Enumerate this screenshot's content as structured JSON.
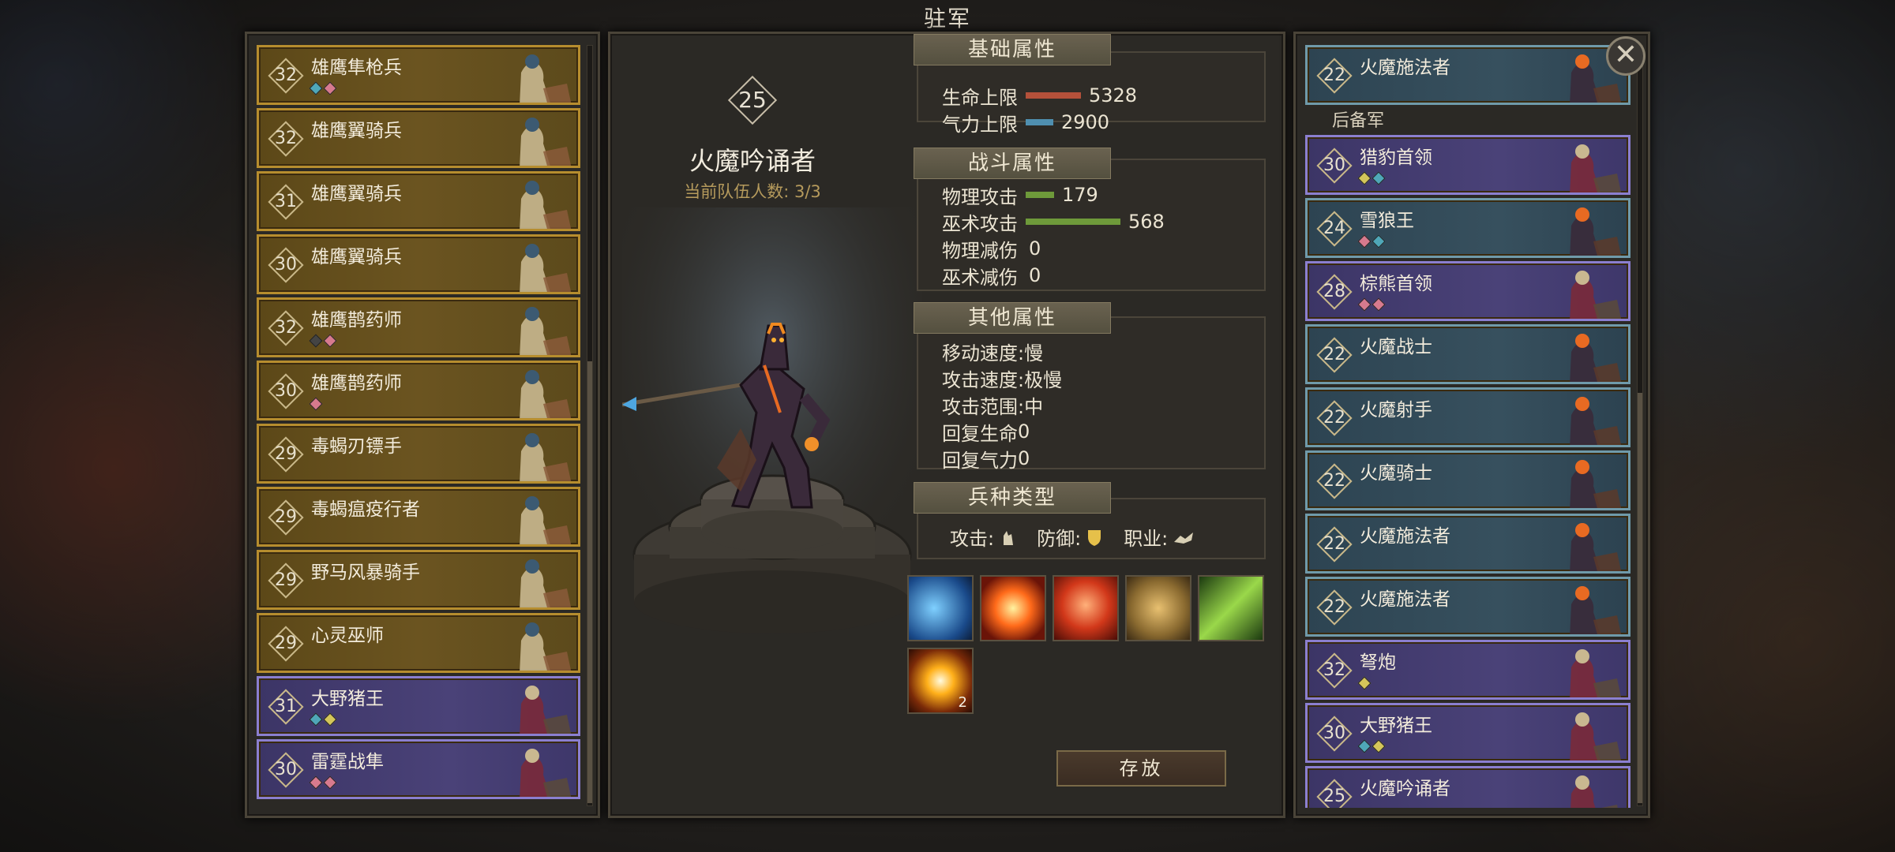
{
  "title": "驻军",
  "left_list": [
    {
      "level": "32",
      "name": "雄鹰隼枪兵",
      "style": "gold",
      "gems": [
        "#4fa7b8",
        "#d77a8e"
      ]
    },
    {
      "level": "32",
      "name": "雄鹰翼骑兵",
      "style": "gold",
      "gems": []
    },
    {
      "level": "31",
      "name": "雄鹰翼骑兵",
      "style": "gold",
      "gems": []
    },
    {
      "level": "30",
      "name": "雄鹰翼骑兵",
      "style": "gold",
      "gems": []
    },
    {
      "level": "32",
      "name": "雄鹰鹊药师",
      "style": "gold",
      "gems": [
        "#444444",
        "#d77a8e"
      ]
    },
    {
      "level": "30",
      "name": "雄鹰鹊药师",
      "style": "gold",
      "gems": [
        "#d77a8e"
      ]
    },
    {
      "level": "29",
      "name": "毒蝎刃镖手",
      "style": "gold",
      "gems": []
    },
    {
      "level": "29",
      "name": "毒蝎瘟疫行者",
      "style": "gold",
      "gems": []
    },
    {
      "level": "29",
      "name": "野马风暴骑手",
      "style": "gold",
      "gems": []
    },
    {
      "level": "29",
      "name": "心灵巫师",
      "style": "gold",
      "gems": []
    },
    {
      "level": "31",
      "name": "大野猪王",
      "style": "purple",
      "gems": [
        "#4fa7b8",
        "#d4c65a"
      ]
    },
    {
      "level": "30",
      "name": "雷霆战隼",
      "style": "purple",
      "gems": [
        "#d77a8e",
        "#d77a8e"
      ]
    }
  ],
  "center": {
    "level": "25",
    "unit_name": "火魔吟诵者",
    "team_count": "当前队伍人数: 3/3",
    "sections": {
      "basic": "基础属性",
      "combat": "战斗属性",
      "other": "其他属性",
      "unit_type": "兵种类型"
    },
    "basic_stats": [
      {
        "label": "生命上限",
        "value": "5328",
        "bar_color": "#b4513a",
        "fill": 0.7
      },
      {
        "label": "气力上限",
        "value": "2900",
        "bar_color": "#4f8fb0",
        "fill": 0.35
      }
    ],
    "combat_stats": [
      {
        "label": "物理攻击",
        "value": "179",
        "bar_color": "#6e9a3a",
        "fill": 0.3
      },
      {
        "label": "巫术攻击",
        "value": "568",
        "bar_color": "#6e9a3a",
        "fill": 1.0
      },
      {
        "label": "物理减伤",
        "value": "0"
      },
      {
        "label": "巫术减伤",
        "value": "0"
      }
    ],
    "other_stats": [
      {
        "label": "移动速度",
        "value": ":慢"
      },
      {
        "label": "攻击速度",
        "value": ":极慢"
      },
      {
        "label": "攻击范围",
        "value": ":中"
      },
      {
        "label": "回复生命",
        "value": "0"
      },
      {
        "label": "回复气力",
        "value": "0"
      }
    ],
    "unit_type": {
      "attack_label": "攻击:",
      "defense_label": "防御:",
      "class_label": "职业:"
    },
    "skills": [
      {
        "icon": "wind-slash-icon",
        "count": ""
      },
      {
        "icon": "fire-burst-icon",
        "count": ""
      },
      {
        "icon": "flame-aura-icon",
        "count": ""
      },
      {
        "icon": "totem-masks-icon",
        "count": ""
      },
      {
        "icon": "poison-blade-icon",
        "count": ""
      },
      {
        "icon": "sun-flare-icon",
        "count": "2"
      }
    ],
    "save_label": "存放"
  },
  "right_top": {
    "level": "22",
    "name": "火魔施法者",
    "style": "blue",
    "gems": []
  },
  "reserve_label": "后备军",
  "right_list": [
    {
      "level": "30",
      "name": "猎豹首领",
      "style": "purple",
      "gems": [
        "#d4c65a",
        "#4fa7b8"
      ]
    },
    {
      "level": "24",
      "name": "雪狼王",
      "style": "blue",
      "gems": [
        "#d77a8e",
        "#4fa7b8"
      ]
    },
    {
      "level": "28",
      "name": "棕熊首领",
      "style": "purple",
      "gems": [
        "#d77a8e",
        "#d77a8e"
      ]
    },
    {
      "level": "22",
      "name": "火魔战士",
      "style": "blue",
      "gems": []
    },
    {
      "level": "22",
      "name": "火魔射手",
      "style": "blue",
      "gems": []
    },
    {
      "level": "22",
      "name": "火魔骑士",
      "style": "blue",
      "gems": []
    },
    {
      "level": "22",
      "name": "火魔施法者",
      "style": "blue",
      "gems": []
    },
    {
      "level": "22",
      "name": "火魔施法者",
      "style": "blue",
      "gems": []
    },
    {
      "level": "32",
      "name": "弩炮",
      "style": "purple",
      "gems": [
        "#d4c65a"
      ]
    },
    {
      "level": "30",
      "name": "大野猪王",
      "style": "purple",
      "gems": [
        "#4fa7b8",
        "#d4c65a"
      ]
    },
    {
      "level": "25",
      "name": "火魔吟诵者",
      "style": "purple",
      "gems": []
    }
  ],
  "close_icon": "close-icon"
}
